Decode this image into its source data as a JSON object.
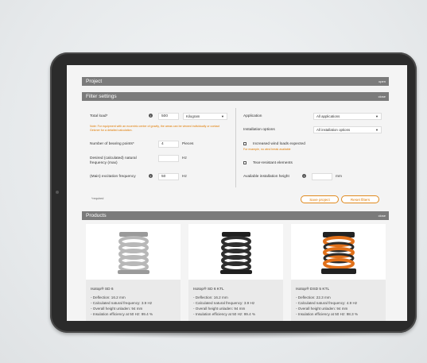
{
  "project_bar": {
    "title": "Project",
    "action": "open"
  },
  "filter_bar": {
    "title": "Filter settings",
    "action": "close"
  },
  "left": {
    "total_load_label": "Total load*",
    "total_load_value": "500",
    "unit_value": "Kilogram",
    "note": "Note: For equipment with an eccentric center of gravity, the areas can be viewed individually or contact Getzner for a detailed calculation.",
    "bearing_label": "Number of bearing points*",
    "bearing_value": "4",
    "bearing_unit": "Pieces",
    "desired_label_1": "Desired (calculated) natural",
    "desired_label_2": "frequency (max)",
    "desired_value": "",
    "desired_unit": "Hz",
    "excitation_label": "(Main) excitation frequency",
    "excitation_value": "50",
    "excitation_unit": "Hz",
    "required": "*required"
  },
  "right": {
    "application_label": "Application",
    "application_value": "All applications",
    "installation_label": "Installation options",
    "installation_value": "All installation options",
    "wind_label": "Increased wind loads expected",
    "wind_note": "For example, no wind break available",
    "tear_label": "Tear-resistant elements",
    "height_label": "Available installation height",
    "height_value": "",
    "height_unit": "mm"
  },
  "buttons": {
    "save": "Save project",
    "reset": "Reset filters"
  },
  "products_bar": {
    "title": "Products",
    "action": "close"
  },
  "products": [
    {
      "name": "Isotop® SD 6",
      "specs": [
        "- Deflection: 16.2 mm",
        "- Calculated natural frequency: 3.9 Hz",
        "- Overall height unladen: 94 mm",
        "- Insulation efficiency at 50 Hz: 99.4 %"
      ],
      "color": "#b5b5b5"
    },
    {
      "name": "Isotop® SD 6 KTL",
      "specs": [
        "- Deflection: 16.2 mm",
        "- Calculated natural frequency: 3.9 Hz",
        "- Overall height unladen: 94 mm",
        "- Insulation efficiency at 50 Hz: 99.4 %"
      ],
      "color": "#2e2e2e"
    },
    {
      "name": "Isotop® DSD 5 KTL",
      "specs": [
        "- Deflection: 22.3 mm",
        "- Calculated natural frequency: 4.9 Hz",
        "- Overall height unladen: 94 mm",
        "- Insulation efficiency at 50 Hz: 98.3 %"
      ],
      "color": "#e0701a"
    }
  ],
  "colors": {
    "accent": "#e07b00",
    "bar": "#7b7b7b"
  }
}
